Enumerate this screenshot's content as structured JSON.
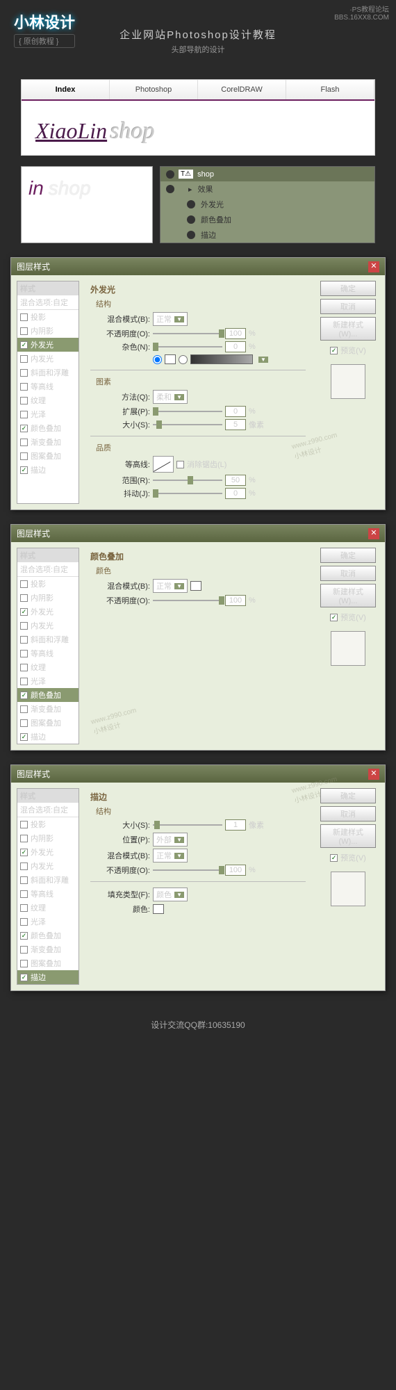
{
  "header": {
    "logo": "小林设计",
    "logo_sub": "{ 原创教程 }",
    "title": "企业网站Photoshop设计教程",
    "subtitle": "头部导航的设计",
    "top_right1": "·PS教程论坛",
    "top_right2": "BBS.16XX8.COM"
  },
  "nav": {
    "tabs": [
      "Index",
      "Photoshop",
      "CorelDRAW",
      "Flash"
    ]
  },
  "logo_preview": {
    "xiaolin": "XiaoLin",
    "shop": "shop",
    "in_text": "in"
  },
  "layers": {
    "name": "shop",
    "effects": "效果",
    "items": [
      "外发光",
      "颜色叠加",
      "描边"
    ]
  },
  "dialog": {
    "title": "图层样式",
    "styles_header": "样式",
    "blend_option": "混合选项:自定",
    "style_list": [
      {
        "label": "投影",
        "checked": false
      },
      {
        "label": "内阴影",
        "checked": false
      },
      {
        "label": "外发光",
        "checked": true
      },
      {
        "label": "内发光",
        "checked": false
      },
      {
        "label": "斜面和浮雕",
        "checked": false
      },
      {
        "label": "等高线",
        "checked": false
      },
      {
        "label": "纹理",
        "checked": false
      },
      {
        "label": "光泽",
        "checked": false
      },
      {
        "label": "颜色叠加",
        "checked": true
      },
      {
        "label": "渐变叠加",
        "checked": false
      },
      {
        "label": "图案叠加",
        "checked": false
      },
      {
        "label": "描边",
        "checked": true
      }
    ],
    "buttons": {
      "ok": "确定",
      "cancel": "取消",
      "new_style": "新建样式(W)...",
      "preview": "预览(V)"
    }
  },
  "panel1": {
    "title": "外发光",
    "structure": "结构",
    "blend_mode_label": "混合模式(B):",
    "blend_mode_value": "正常",
    "opacity_label": "不透明度(O):",
    "opacity_value": "100",
    "noise_label": "杂色(N):",
    "noise_value": "0",
    "elements": "图素",
    "method_label": "方法(Q):",
    "method_value": "柔和",
    "spread_label": "扩展(P):",
    "spread_value": "0",
    "size_label": "大小(S):",
    "size_value": "5",
    "size_unit": "像素",
    "quality": "品质",
    "contour_label": "等高线:",
    "anti_alias": "消除锯齿(L)",
    "range_label": "范围(R):",
    "range_value": "50",
    "jitter_label": "抖动(J):",
    "jitter_value": "0",
    "percent": "%"
  },
  "panel2": {
    "title": "颜色叠加",
    "color_section": "颜色",
    "blend_mode_label": "混合模式(B):",
    "blend_mode_value": "正常",
    "opacity_label": "不透明度(O):",
    "opacity_value": "100",
    "percent": "%"
  },
  "panel3": {
    "title": "描边",
    "structure": "结构",
    "size_label": "大小(S):",
    "size_value": "1",
    "size_unit": "像素",
    "position_label": "位置(P):",
    "position_value": "外部",
    "blend_mode_label": "混合模式(B):",
    "blend_mode_value": "正常",
    "opacity_label": "不透明度(O):",
    "opacity_value": "100",
    "percent": "%",
    "fill_type_label": "填充类型(F):",
    "fill_type_value": "颜色",
    "color_label": "颜色:"
  },
  "watermark": {
    "url": "www.z990.com",
    "name": "小林设计"
  },
  "footer": "设计交流QQ群:10635190"
}
